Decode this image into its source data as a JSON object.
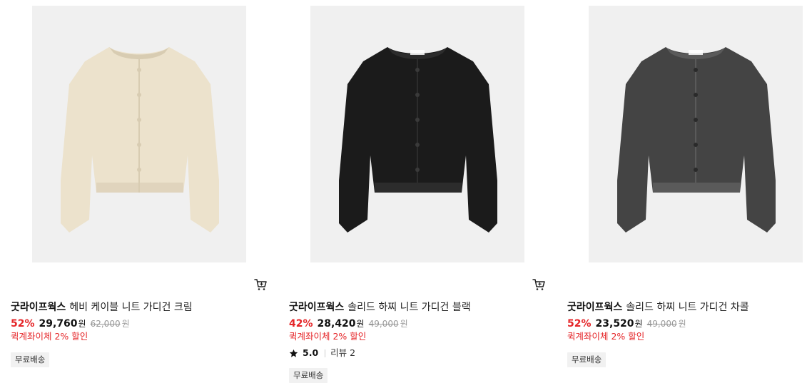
{
  "products": [
    {
      "brand": "굿라이프웍스",
      "name": "헤비 케이블 니트 가디건 크림",
      "discount": "52%",
      "price": "29,760",
      "currency": "원",
      "original_price": "62,000",
      "original_currency": "원",
      "promo": "퀵계좌이체 2% 할인",
      "badge": "무료배송",
      "image_color": "#ece2cc",
      "image_shade": "#d8ccb2",
      "icon": "cart-icon"
    },
    {
      "brand": "굿라이프웍스",
      "name": "솔리드 하찌 니트 가디건 블랙",
      "discount": "42%",
      "price": "28,420",
      "currency": "원",
      "original_price": "49,000",
      "original_currency": "원",
      "promo": "퀵계좌이체 2% 할인",
      "rating": "5.0",
      "review": "리뷰 2",
      "badge": "무료배송",
      "image_color": "#1b1b1b",
      "image_shade": "#2c2c2c",
      "icon": "cart-icon"
    },
    {
      "brand": "굿라이프웍스",
      "name": "솔리드 하찌 니트 가디건 차콜",
      "discount": "52%",
      "price": "23,520",
      "currency": "원",
      "original_price": "49,000",
      "original_currency": "원",
      "promo": "퀵계좌이체 2% 할인",
      "badge": "무료배송",
      "image_color": "#444444",
      "image_shade": "#5a5a5a",
      "icon": "cart-icon"
    }
  ],
  "colors": {
    "accent": "#e52528",
    "image_bg": "#f0f0f0",
    "badge_bg": "#f1f1f1"
  }
}
